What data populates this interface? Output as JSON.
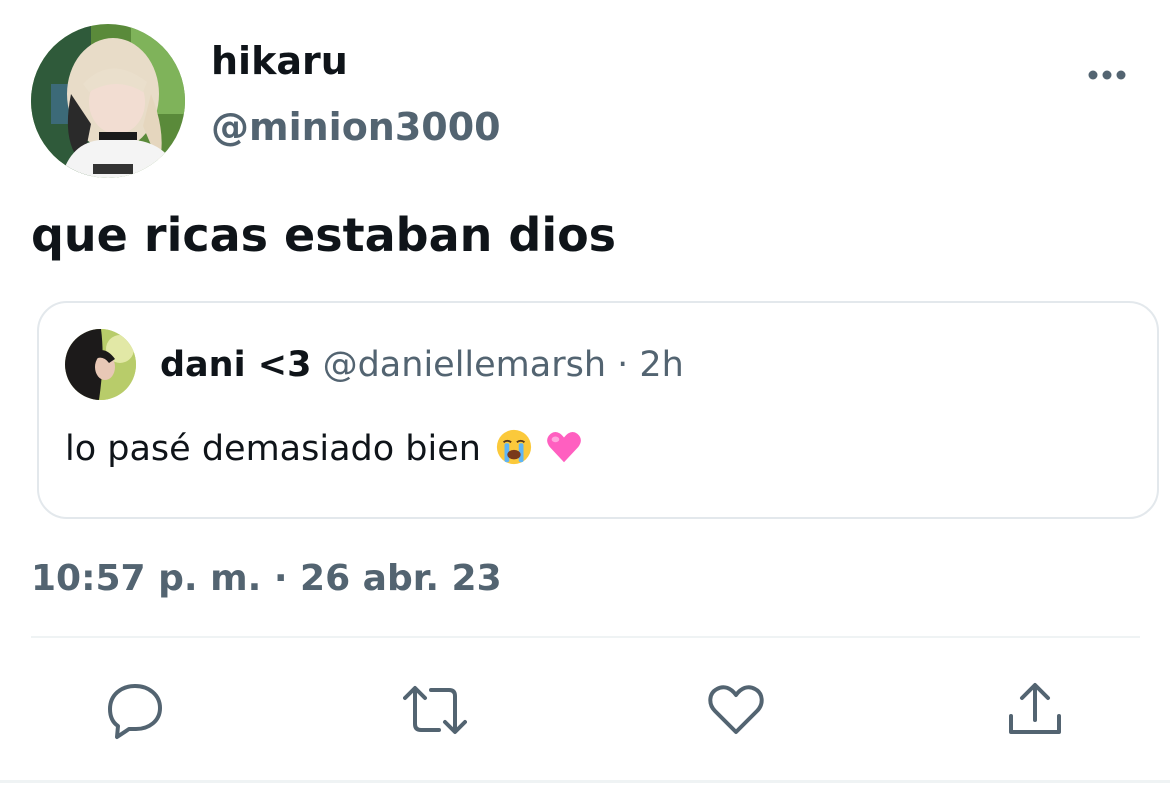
{
  "tweet": {
    "author": {
      "display_name": "hikaru",
      "handle": "@minion3000",
      "avatar_icon": "profile-photo"
    },
    "text": "que ricas estaban dios",
    "timestamp": "10:57 p. m. · 26 abr. 23"
  },
  "quoted_tweet": {
    "display_name": "dani <3",
    "handle_and_time": "@daniellemarsh · 2h",
    "text": "lo pasé demasiado bien",
    "emojis": [
      "loudly-crying-face",
      "pink-heart"
    ]
  },
  "actions": [
    {
      "name": "reply",
      "icon": "reply-icon"
    },
    {
      "name": "retweet",
      "icon": "retweet-icon"
    },
    {
      "name": "like",
      "icon": "heart-icon"
    },
    {
      "name": "share",
      "icon": "share-icon"
    }
  ],
  "colors": {
    "text_primary": "#0f1419",
    "text_secondary": "#536471",
    "border": "#e3e8ec",
    "pink_heart": "#ff5fc0"
  }
}
